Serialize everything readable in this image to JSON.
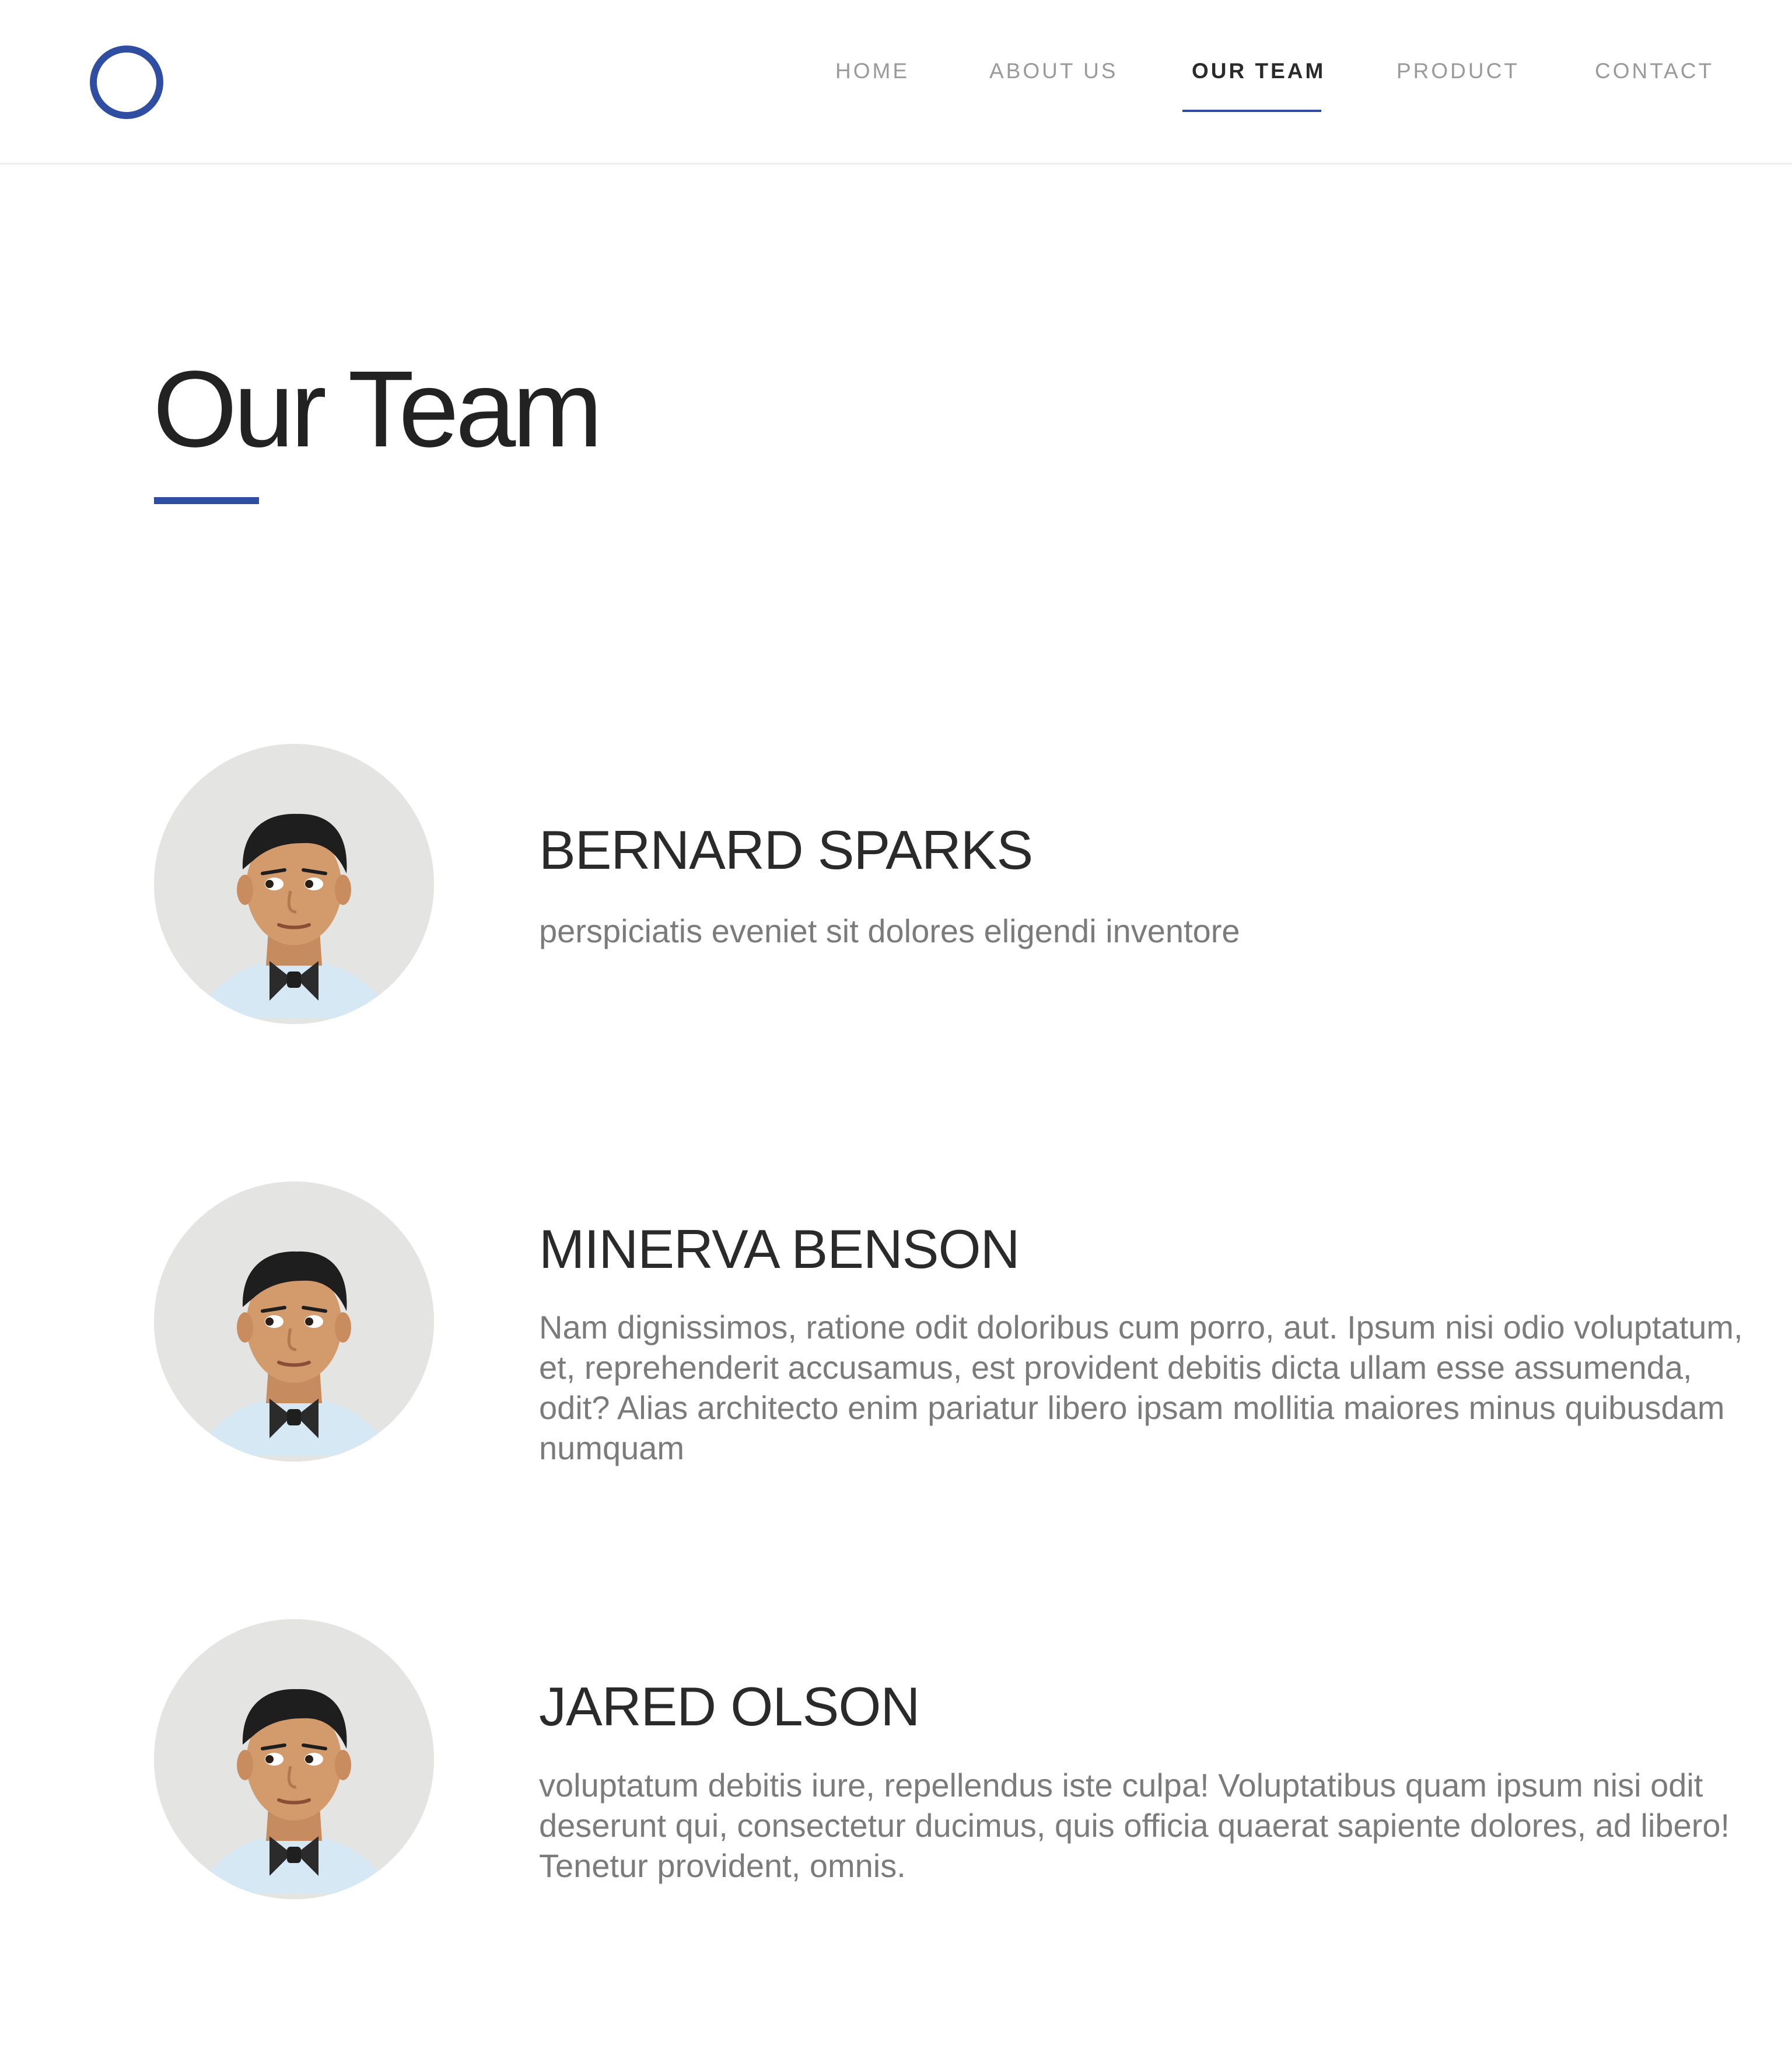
{
  "header": {
    "logo_icon": "circle-logo-icon",
    "nav": [
      {
        "label": "HOME",
        "active": false
      },
      {
        "label": "ABOUT US",
        "active": false
      },
      {
        "label": "OUR TEAM",
        "active": true
      },
      {
        "label": "PRODUCT",
        "active": false
      },
      {
        "label": "CONTACT",
        "active": false
      }
    ]
  },
  "main": {
    "title": "Our Team",
    "team": [
      {
        "name": "BERNARD SPARKS",
        "bio": " perspiciatis eveniet sit dolores eligendi inventore"
      },
      {
        "name": "MINERVA BENSON",
        "bio": "Nam dignissimos, ratione odit doloribus cum porro, aut. Ipsum nisi odio voluptatum, et, reprehenderit accusamus, est provident debitis dicta ullam esse assumenda, odit? Alias architecto enim pariatur libero ipsam mollitia maiores minus quibusdam numquam"
      },
      {
        "name": "JARED OLSON",
        "bio": "voluptatum debitis iure, repellendus iste culpa! Voluptatibus quam ipsum nisi odit deserunt qui, consectetur ducimus, quis officia quaerat sapiente dolores, ad libero! Tenetur provident, omnis."
      }
    ]
  },
  "colors": {
    "accent": "#2f4ea2",
    "text_dark": "#222222",
    "text_muted": "#7b7b7b",
    "nav_inactive": "#9a9a9a",
    "avatar_bg": "#e4e4e3"
  }
}
